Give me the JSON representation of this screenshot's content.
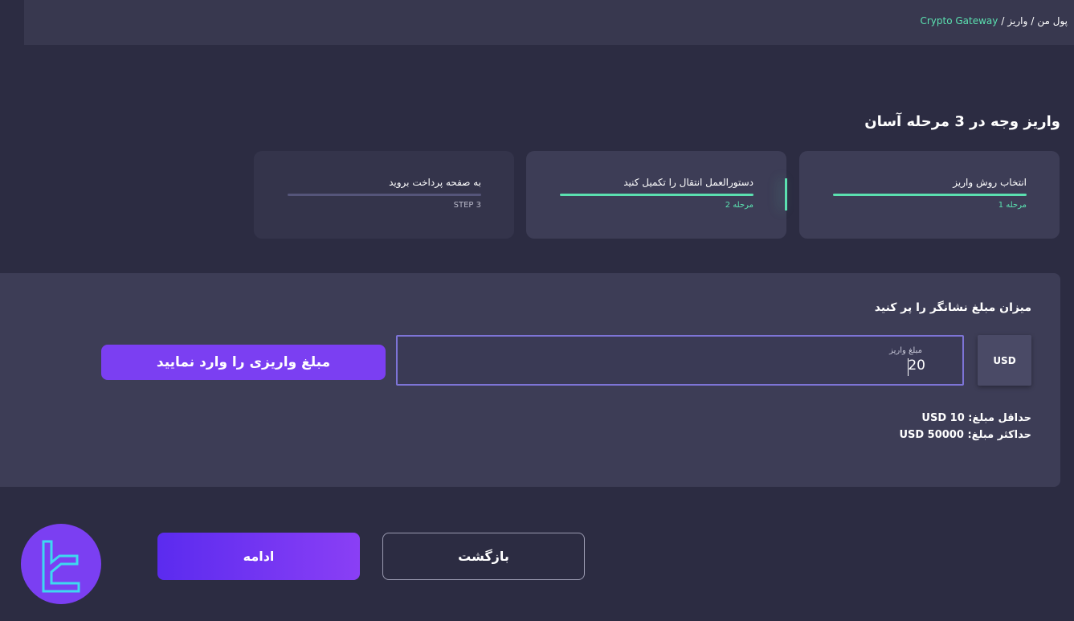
{
  "breadcrumb": {
    "item1": "پول من",
    "sep1": "/",
    "item2": "واریز",
    "sep2": "/",
    "current": "Crypto Gateway"
  },
  "heading": {
    "before": "واریز وجه در ",
    "number": "3",
    "after": " مرحله آسان"
  },
  "steps": [
    {
      "title": "انتخاب روش واریز",
      "sub": "مرحله 1"
    },
    {
      "title": "دستورالعمل انتقال را تکمیل کنید",
      "sub": "مرحله 2"
    },
    {
      "title": "به صفحه پرداخت بروید",
      "sub": "STEP 3"
    }
  ],
  "panel": {
    "title": "میزان مبلغ نشانگر را پر کنید",
    "currency": "USD",
    "amount_label": "مبلغ واریز",
    "amount_value": "20",
    "callout": "مبلغ واریزی را وارد نمایید",
    "min_label": "حداقل مبلغ:",
    "min_value": "USD 10",
    "max_label": "حداکثر مبلغ:",
    "max_value": "USD 50000"
  },
  "buttons": {
    "back": "بازگشت",
    "continue": "ادامه"
  },
  "colors": {
    "background": "#2c2c42",
    "accent_green": "#5be0b0",
    "accent_purple": "#7b3ff2"
  },
  "icons": {
    "logo": "brand-logo-icon"
  }
}
